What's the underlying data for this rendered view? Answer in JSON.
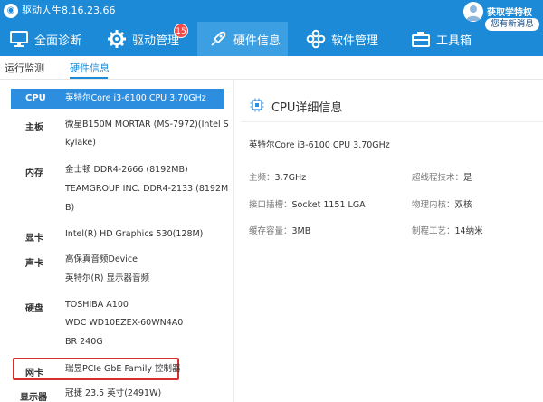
{
  "app": {
    "title": "驱动人生8.16.23.66"
  },
  "nav": [
    {
      "label": "全面诊断",
      "icon": "monitor-icon"
    },
    {
      "label": "驱动管理",
      "icon": "gear-icon",
      "badge": "15"
    },
    {
      "label": "硬件信息",
      "icon": "rocket-icon",
      "active": true
    },
    {
      "label": "软件管理",
      "icon": "apps-icon"
    },
    {
      "label": "工具箱",
      "icon": "toolbox-icon"
    }
  ],
  "user": {
    "vip_label": "获取学特权",
    "messages": "您有新消息"
  },
  "subtabs": [
    {
      "label": "运行监测"
    },
    {
      "label": "硬件信息",
      "active": true
    }
  ],
  "hardware": [
    {
      "label": "CPU",
      "lines": [
        "英特尔Core i3-6100 CPU 3.70GHz"
      ],
      "selected": true
    },
    {
      "label": "主板",
      "lines": [
        "微星B150M MORTAR (MS-7972)(Intel S",
        "kylake)"
      ]
    },
    {
      "label": "内存",
      "lines": [
        "金士顿 DDR4-2666 (8192MB)",
        "TEAMGROUP INC. DDR4-2133 (8192M",
        "B)"
      ]
    },
    {
      "label": "显卡",
      "lines": [
        "Intel(R) HD Graphics 530(128M)"
      ]
    },
    {
      "label": "声卡",
      "lines": [
        "高保真音频Device",
        "英特尔(R) 显示器音频"
      ]
    },
    {
      "label": "硬盘",
      "lines": [
        "TOSHIBA A100",
        "WDC WD10EZEX-60WN4A0",
        "BR 240G"
      ]
    },
    {
      "label": "网卡",
      "lines": [
        "瑞昱PCIe GbE Family 控制器"
      ],
      "highlighted": true
    },
    {
      "label": "显示器",
      "lines": [
        "冠捷 23.5 英寸(2491W)"
      ]
    }
  ],
  "detail": {
    "title": "CPU详细信息",
    "cpu_name": "英特尔Core i3-6100 CPU 3.70GHz",
    "specs": [
      {
        "label": "主频：",
        "value": "3.7GHz"
      },
      {
        "label": "超线程技术：",
        "value": "是"
      },
      {
        "label": "接口插槽：",
        "value": "Socket 1151 LGA"
      },
      {
        "label": "物理内核：",
        "value": "双核"
      },
      {
        "label": "缓存容量：",
        "value": "3MB"
      },
      {
        "label": "制程工艺：",
        "value": "14纳米"
      }
    ]
  },
  "colors": {
    "brand_blue": "#1c8ad6",
    "selected_blue": "#2d8ee0",
    "highlight_red": "#d53030",
    "badge_red": "#f04b4b"
  }
}
